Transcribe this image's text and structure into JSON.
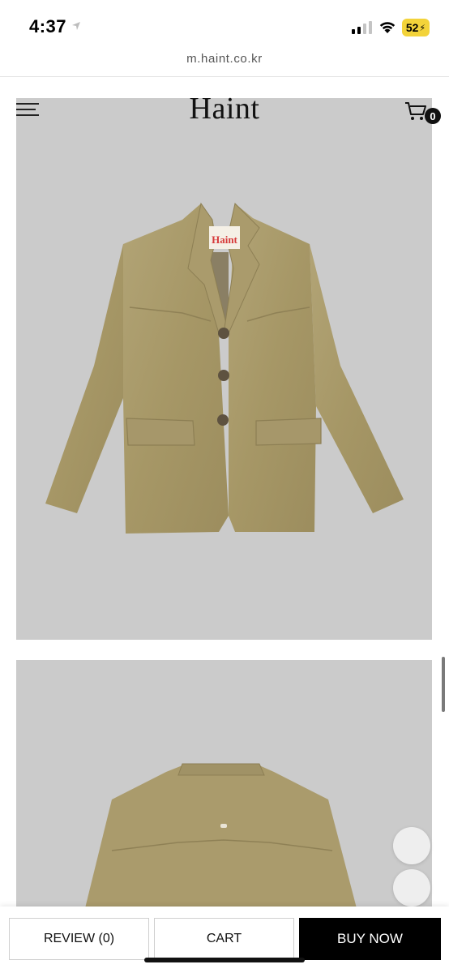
{
  "status_bar": {
    "time": "4:37",
    "battery": "52",
    "icons": [
      "location-arrow-icon",
      "signal-icon",
      "wifi-icon",
      "battery-icon"
    ]
  },
  "browser": {
    "url": "m.haint.co.kr"
  },
  "header": {
    "brand": "Haint",
    "cart_count": "0",
    "icons": [
      "menu-icon",
      "cart-icon"
    ]
  },
  "product": {
    "label_text": "Haint",
    "images": [
      "jacket-front-image",
      "jacket-back-image"
    ],
    "colors": {
      "image_background": "#cbcbcb",
      "jacket": "#a99a6b"
    }
  },
  "bottom_bar": {
    "review_label": "REVIEW (0)",
    "cart_label": "CART",
    "buy_label": "BUY NOW"
  }
}
